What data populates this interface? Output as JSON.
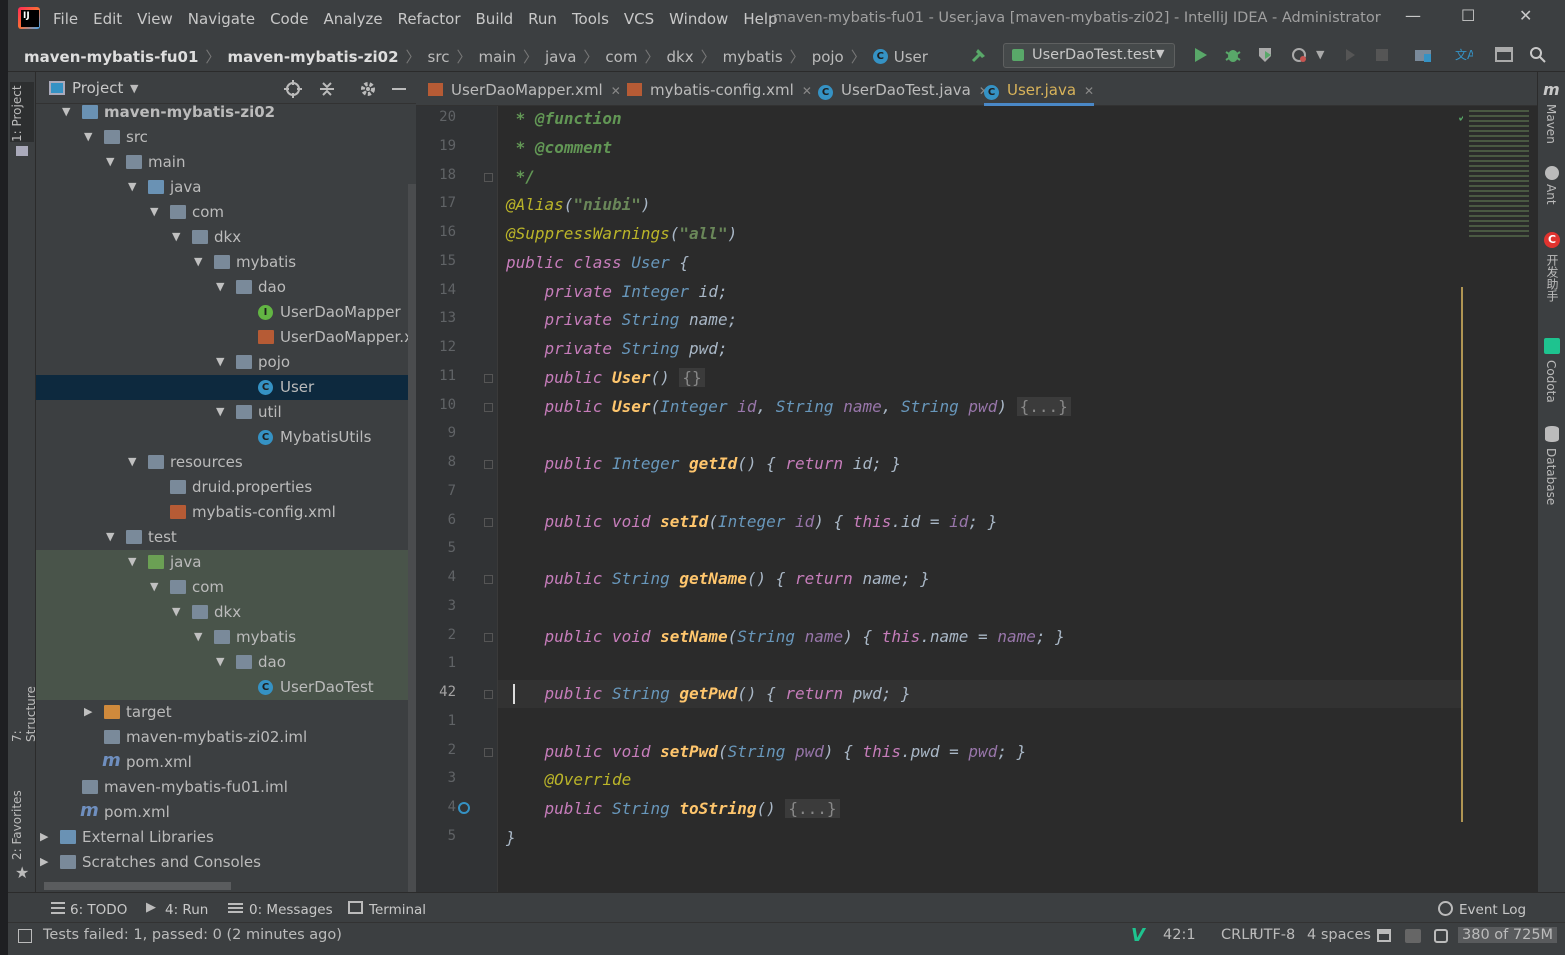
{
  "window": {
    "title": "maven-mybatis-fu01 - User.java [maven-mybatis-zi02] - IntelliJ IDEA - Administrator",
    "menu": [
      "File",
      "Edit",
      "View",
      "Navigate",
      "Code",
      "Analyze",
      "Refactor",
      "Build",
      "Run",
      "Tools",
      "VCS",
      "Window",
      "Help"
    ],
    "controls": {
      "minimize": "—",
      "maximize": "☐",
      "close": "✕"
    }
  },
  "breadcrumbs": [
    "maven-mybatis-fu01",
    "maven-mybatis-zi02",
    "src",
    "main",
    "java",
    "com",
    "dkx",
    "mybatis",
    "pojo",
    "User"
  ],
  "toolbar": {
    "run_config": "UserDaoTest.test"
  },
  "project_panel": {
    "title": "Project",
    "tree": [
      {
        "label": "maven-mybatis-zi02",
        "icon": "module-folder-icon",
        "depth": 0,
        "open": true,
        "bold": true
      },
      {
        "label": "src",
        "icon": "folder-icon",
        "depth": 1,
        "open": true
      },
      {
        "label": "main",
        "icon": "folder-icon",
        "depth": 2,
        "open": true
      },
      {
        "label": "java",
        "icon": "source-folder-icon",
        "depth": 3,
        "open": true
      },
      {
        "label": "com",
        "icon": "package-icon",
        "depth": 4,
        "open": true
      },
      {
        "label": "dkx",
        "icon": "package-icon",
        "depth": 5,
        "open": true
      },
      {
        "label": "mybatis",
        "icon": "package-icon",
        "depth": 6,
        "open": true
      },
      {
        "label": "dao",
        "icon": "package-icon",
        "depth": 7,
        "open": true
      },
      {
        "label": "UserDaoMapper",
        "icon": "interface-icon",
        "depth": 8
      },
      {
        "label": "UserDaoMapper.xml",
        "icon": "xml-file-icon",
        "depth": 8
      },
      {
        "label": "pojo",
        "icon": "package-icon",
        "depth": 7,
        "open": true
      },
      {
        "label": "User",
        "icon": "class-icon",
        "depth": 8,
        "selected": true
      },
      {
        "label": "util",
        "icon": "package-icon",
        "depth": 7,
        "open": true
      },
      {
        "label": "MybatisUtils",
        "icon": "class-icon",
        "depth": 8
      },
      {
        "label": "resources",
        "icon": "resources-folder-icon",
        "depth": 3,
        "open": true
      },
      {
        "label": "druid.properties",
        "icon": "properties-file-icon",
        "depth": 4
      },
      {
        "label": "mybatis-config.xml",
        "icon": "xml-file-icon",
        "depth": 4
      },
      {
        "label": "test",
        "icon": "folder-icon",
        "depth": 2,
        "open": true
      },
      {
        "label": "java",
        "icon": "test-folder-icon",
        "depth": 3,
        "open": true,
        "green": true
      },
      {
        "label": "com",
        "icon": "package-icon",
        "depth": 4,
        "open": true,
        "green": true
      },
      {
        "label": "dkx",
        "icon": "package-icon",
        "depth": 5,
        "open": true,
        "green": true
      },
      {
        "label": "mybatis",
        "icon": "package-icon",
        "depth": 6,
        "open": true,
        "green": true
      },
      {
        "label": "dao",
        "icon": "package-icon",
        "depth": 7,
        "open": true,
        "green": true
      },
      {
        "label": "UserDaoTest",
        "icon": "test-class-icon",
        "depth": 8,
        "green": true
      },
      {
        "label": "target",
        "icon": "excluded-folder-icon",
        "depth": 1,
        "open": false
      },
      {
        "label": "maven-mybatis-zi02.iml",
        "icon": "iml-file-icon",
        "depth": 1
      },
      {
        "label": "pom.xml",
        "icon": "maven-icon",
        "depth": 1
      },
      {
        "label": "maven-mybatis-fu01.iml",
        "icon": "iml-file-icon",
        "depth": 0
      },
      {
        "label": "pom.xml",
        "icon": "maven-icon",
        "depth": 0
      },
      {
        "label": "External Libraries",
        "icon": "libraries-icon",
        "depth": -1,
        "open": false
      },
      {
        "label": "Scratches and Consoles",
        "icon": "scratches-icon",
        "depth": -1,
        "open": false
      }
    ]
  },
  "editor_tabs": [
    {
      "label": "UserDaoMapper.xml",
      "icon": "xml-file-icon"
    },
    {
      "label": "mybatis-config.xml",
      "icon": "xml-file-icon"
    },
    {
      "label": "UserDaoTest.java",
      "icon": "test-class-icon"
    },
    {
      "label": "User.java",
      "icon": "class-icon",
      "active": true
    }
  ],
  "editor": {
    "line_numbers": [
      "20",
      "19",
      "18",
      "17",
      "16",
      "15",
      "14",
      "13",
      "12",
      "11",
      "10",
      "9",
      "8",
      "7",
      "6",
      "5",
      "4",
      "3",
      "2",
      "1",
      "42",
      "1",
      "2",
      "3",
      "4",
      "5"
    ],
    "lines": [
      " * @function",
      " * @comment",
      " */",
      "@Alias(\"niubi\")",
      "@SuppressWarnings(\"all\")",
      "public class User {",
      "    private Integer id;",
      "    private String name;",
      "    private String pwd;",
      "    public User() {}",
      "    public User(Integer id, String name, String pwd) {...}",
      "",
      "    public Integer getId() { return id; }",
      "",
      "    public void setId(Integer id) { this.id = id; }",
      "",
      "    public String getName() { return name; }",
      "",
      "    public void setName(String name) { this.name = name; }",
      "",
      "    public String getPwd() { return pwd; }",
      "",
      "    public void setPwd(String pwd) { this.pwd = pwd; }",
      "    @Override",
      "    public String toString() {...}",
      "}"
    ],
    "current_line": "42"
  },
  "right_tools": [
    "Maven",
    "Ant",
    "开发助手",
    "Codota",
    "Database"
  ],
  "left_tools": [
    "1: Project",
    "7: Structure",
    "2: Favorites"
  ],
  "bottom_tabs": [
    {
      "label": "6: TODO",
      "icon": "todo-icon"
    },
    {
      "label": "4: Run",
      "icon": "run-icon"
    },
    {
      "label": "0: Messages",
      "icon": "messages-icon"
    },
    {
      "label": "Terminal",
      "icon": "terminal-icon"
    }
  ],
  "event_log": "Event Log",
  "status": {
    "message": "Tests failed: 1, passed: 0 (2 minutes ago)",
    "position": "42:1",
    "line_sep": "CRLF",
    "encoding": "UTF-8",
    "indent": "4 spaces",
    "memory": "380 of 725M"
  }
}
